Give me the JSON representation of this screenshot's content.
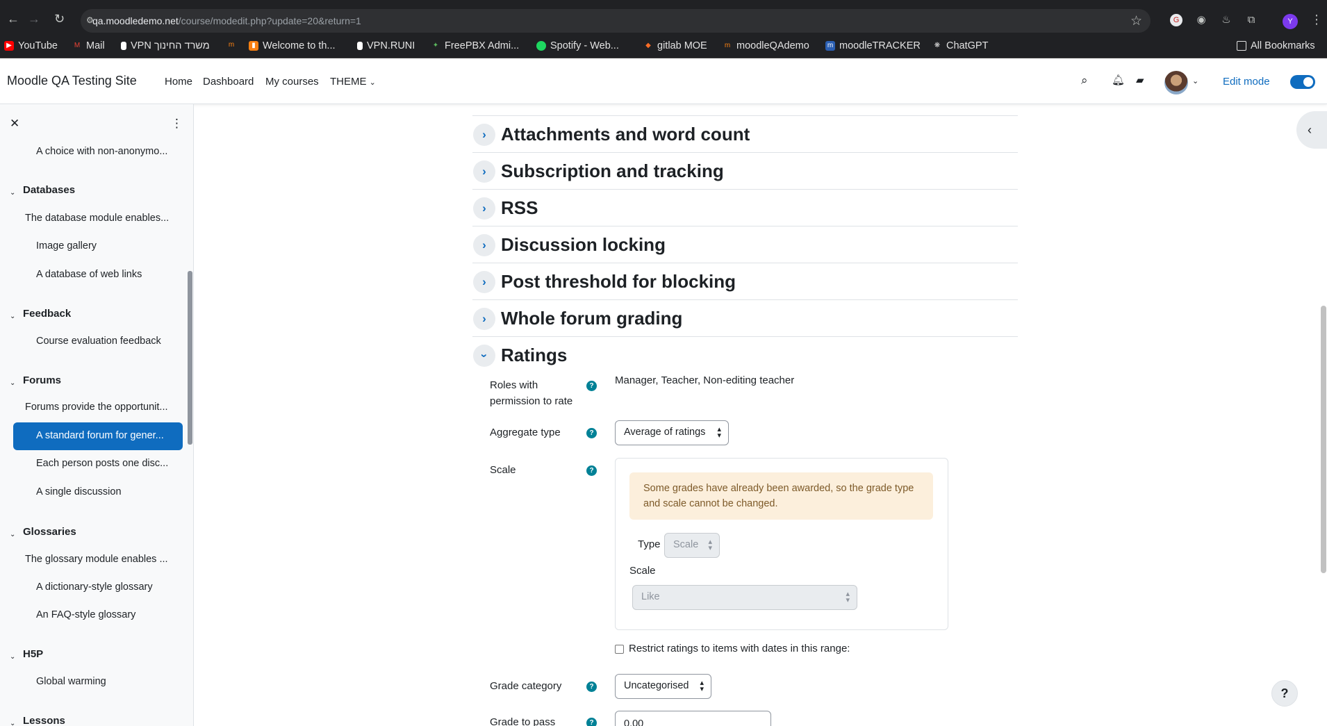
{
  "browser": {
    "url_host": "qa.moodledemo.net",
    "url_path": "/course/modedit.php?update=20&return=1",
    "profile_initial": "Y",
    "bookmarks": [
      "YouTube",
      "Mail",
      "VPN משרד החינוך",
      "Welcome to th...",
      "VPN.RUNI",
      "FreePBX Admi...",
      "Spotify - Web...",
      "gitlab MOE",
      "moodleQAdemo",
      "moodleTRACKER",
      "ChatGPT"
    ],
    "all_bookmarks": "All Bookmarks"
  },
  "navbar": {
    "site_name": "Moodle QA Testing Site",
    "links": [
      "Home",
      "Dashboard",
      "My courses",
      "THEME"
    ],
    "edit_mode": "Edit mode"
  },
  "drawer": {
    "items": [
      {
        "label": "A choice with non-anonymo..."
      },
      {
        "section": "Databases"
      },
      {
        "label": "The database module enables..."
      },
      {
        "label": "Image gallery"
      },
      {
        "label": "A database of web links"
      },
      {
        "section": "Feedback"
      },
      {
        "label": "Course evaluation feedback"
      },
      {
        "section": "Forums"
      },
      {
        "label": "Forums provide the opportunit..."
      },
      {
        "label": "A standard forum for gener..."
      },
      {
        "label": "Each person posts one disc..."
      },
      {
        "label": "A single discussion"
      },
      {
        "section": "Glossaries"
      },
      {
        "label": "The glossary module enables ..."
      },
      {
        "label": "A dictionary-style glossary"
      },
      {
        "label": "An FAQ-style glossary"
      },
      {
        "section": "H5P"
      },
      {
        "label": "Global warming"
      },
      {
        "section": "Lessons"
      }
    ]
  },
  "sections": [
    "Attachments and word count",
    "Subscription and tracking",
    "RSS",
    "Discussion locking",
    "Post threshold for blocking",
    "Whole forum grading",
    "Ratings"
  ],
  "ratings": {
    "roles_label": "Roles with permission to rate",
    "roles_value": "Manager, Teacher, Non-editing teacher",
    "aggregate_label": "Aggregate type",
    "aggregate_value": "Average of ratings",
    "scale_label": "Scale",
    "alert": "Some grades have already been awarded, so the grade type and scale cannot be changed.",
    "type_label": "Type",
    "type_value": "Scale",
    "inner_scale_label": "Scale",
    "inner_scale_value": "Like",
    "restrict_label": "Restrict ratings to items with dates in this range:",
    "grade_category_label": "Grade category",
    "grade_category_value": "Uncategorised",
    "grade_pass_label": "Grade to pass",
    "grade_pass_value": "0.00"
  },
  "colors": {
    "primary": "#0f6cbf",
    "help": "#008196",
    "alert_bg": "#fcefdc"
  }
}
